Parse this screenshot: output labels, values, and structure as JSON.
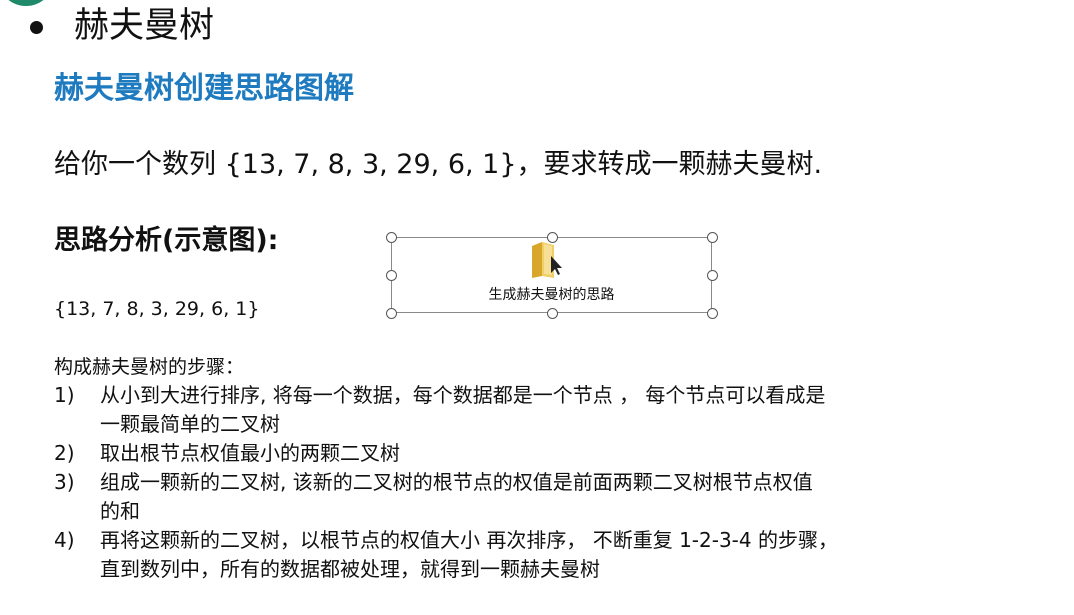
{
  "slide_title": "赫夫曼树",
  "section_title": "赫夫曼树创建思路图解",
  "problem": "给你一个数列 {13, 7, 8, 3, 29, 6, 1}，要求转成一颗赫夫曼树.",
  "analysis_title": "思路分析(示意图):",
  "sequence": "{13, 7, 8, 3, 29, 6, 1}",
  "embedded_object": {
    "caption": "生成赫夫曼树的思路",
    "icon": "folder-icon"
  },
  "steps_title": "构成赫夫曼树的步骤：",
  "steps": [
    {
      "num": "1)",
      "lines": [
        "从小到大进行排序, 将每一个数据，每个数据都是一个节点 ， 每个节点可以看成是",
        "一颗最简单的二叉树"
      ]
    },
    {
      "num": "2)",
      "lines": [
        "取出根节点权值最小的两颗二叉树"
      ]
    },
    {
      "num": "3)",
      "lines": [
        "组成一颗新的二叉树, 该新的二叉树的根节点的权值是前面两颗二叉树根节点权值",
        "的和"
      ]
    },
    {
      "num": "4)",
      "lines": [
        "再将这颗新的二叉树，以根节点的权值大小 再次排序， 不断重复  1-2-3-4 的步骤，",
        "直到数列中，所有的数据都被处理，就得到一颗赫夫曼树"
      ]
    }
  ],
  "colors": {
    "heading_blue": "#1f7bbf",
    "text": "#111111"
  }
}
